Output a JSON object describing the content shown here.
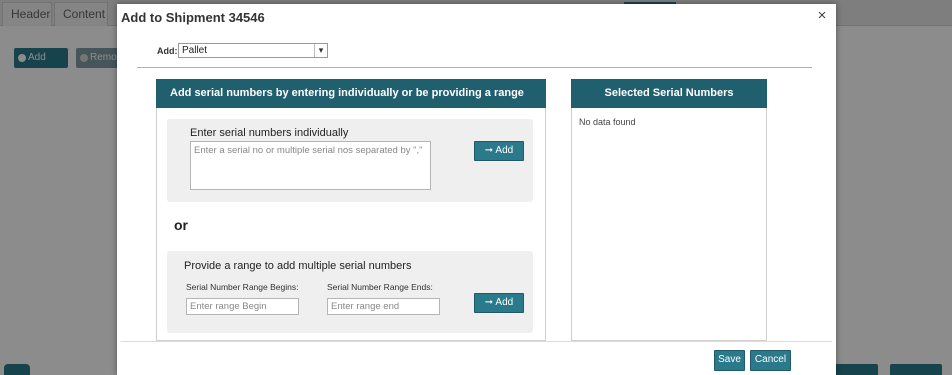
{
  "background": {
    "tabs": [
      "Header",
      "Content"
    ],
    "toolbar": {
      "add_label": "Add",
      "remove_label": "Remo"
    }
  },
  "modal": {
    "title": "Add to Shipment 34546",
    "close_label": "×",
    "add_field": {
      "label": "Add:",
      "selected": "Pallet"
    },
    "left_panel": {
      "header": "Add serial numbers by entering individually or be providing a range",
      "individual": {
        "title": "Enter serial numbers individually",
        "placeholder": "Enter a serial no or multiple serial nos separated by \",\"",
        "add_button": "➞ Add"
      },
      "or_text": "or",
      "range": {
        "title": "Provide a range to add multiple serial numbers",
        "begin_label": "Serial Number Range Begins:",
        "begin_placeholder": "Enter range Begin",
        "end_label": "Serial Number Range Ends:",
        "end_placeholder": "Enter range end",
        "add_button": "➞ Add"
      }
    },
    "right_panel": {
      "header": "Selected Serial Numbers",
      "empty_text": "No data found"
    },
    "footer": {
      "save_label": "Save",
      "cancel_label": "Cancel"
    }
  },
  "colors": {
    "accent": "#2a7a8c",
    "panel_header": "#1f5f6e",
    "section_bg": "#efefef"
  }
}
